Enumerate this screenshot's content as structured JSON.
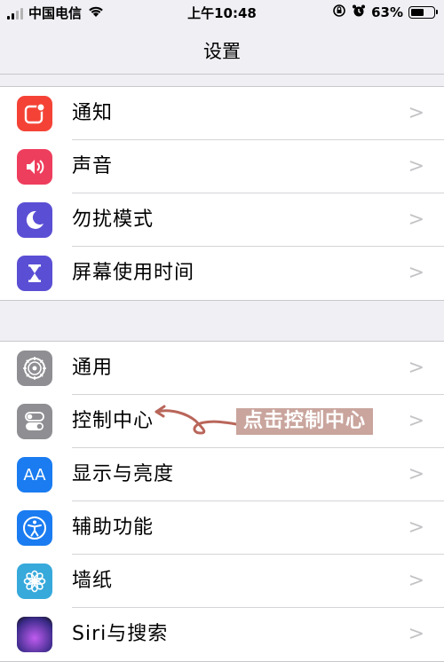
{
  "status_bar": {
    "carrier": "中国电信",
    "time": "上午10:48",
    "battery_percent": "63%",
    "battery_level": 0.63,
    "icons": [
      "signal-icon",
      "wifi-icon",
      "rotation-lock-icon",
      "alarm-icon",
      "battery-icon"
    ]
  },
  "nav": {
    "title": "设置"
  },
  "groups": [
    {
      "items": [
        {
          "label": "通知",
          "icon": "notifications-icon",
          "color": "#f44336"
        },
        {
          "label": "声音",
          "icon": "speaker-icon",
          "color": "#ee3e5d"
        },
        {
          "label": "勿扰模式",
          "icon": "moon-icon",
          "color": "#5a4fd4"
        },
        {
          "label": "屏幕使用时间",
          "icon": "hourglass-icon",
          "color": "#5a4fd4"
        }
      ]
    },
    {
      "items": [
        {
          "label": "通用",
          "icon": "gear-icon",
          "color": "#8e8e93"
        },
        {
          "label": "控制中心",
          "icon": "toggles-icon",
          "color": "#8e8e93"
        },
        {
          "label": "显示与亮度",
          "icon": "aa-icon",
          "color": "#1a7cf0",
          "icon_text": "AA"
        },
        {
          "label": "辅助功能",
          "icon": "accessibility-icon",
          "color": "#1a7cf0"
        },
        {
          "label": "墙纸",
          "icon": "flower-icon",
          "color": "#37a9db"
        },
        {
          "label": "Siri与搜索",
          "icon": "siri-icon",
          "color": "#3b2b8a"
        }
      ]
    }
  ],
  "annotation": {
    "text": "点击控制中心",
    "color": "#c9a59d"
  }
}
